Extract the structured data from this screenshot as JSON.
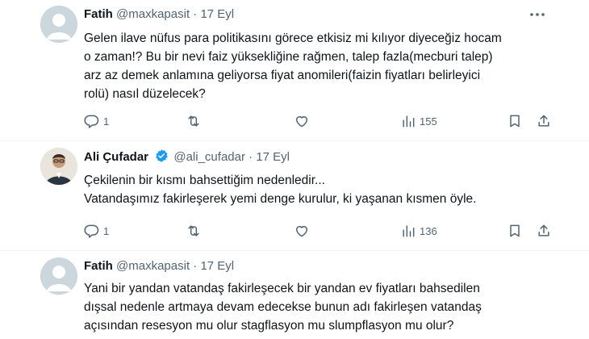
{
  "tweets": [
    {
      "name": "Fatih",
      "handle": "@maxkapasit",
      "dot": "·",
      "date": "17 Eyl",
      "text_lines": [
        "Gelen ilave nüfus para politikasını görece etkisiz mi kılıyor diyeceğiz hocam",
        "o zaman!? Bu bir nevi faiz yüksekliğine rağmen, talep fazla(mecburi talep)",
        "arz az demek anlamına geliyorsa fiyat anomileri(faizin fiyatları belirleyici",
        "rolü) nasıl düzelecek?"
      ],
      "replies": "1",
      "retweets": "",
      "likes": "",
      "views": "155"
    },
    {
      "name": "Ali Çufadar",
      "handle": "@ali_cufadar",
      "dot": "·",
      "date": "17 Eyl",
      "text_lines": [
        "Çekilenin bir kısmı bahsettiğim nedenledir...",
        "Vatandaşımız fakirleşerek yemi denge kurulur, ki yaşanan kısmen öyle."
      ],
      "replies": "1",
      "retweets": "",
      "likes": "",
      "views": "136"
    },
    {
      "name": "Fatih",
      "handle": "@maxkapasit",
      "dot": "·",
      "date": "17 Eyl",
      "text_lines": [
        "Yani bir yandan vatandaş fakirleşecek bir yandan ev fiyatları bahsedilen",
        "dışsal nedenle artmaya devam edecekse bunun adı fakirleşen vatandaş",
        "açısından resesyon mu olur stagflasyon mu slumpflasyon mu olur?"
      ]
    }
  ],
  "icons": {
    "reply": "reply-icon",
    "retweet": "retweet-icon",
    "like": "heart-icon",
    "views": "views-icon",
    "bookmark": "bookmark-icon",
    "share": "share-icon",
    "more": "more-icon",
    "verified": "verified-badge-icon"
  },
  "colors": {
    "verified": "#1d9bf0",
    "muted": "#536471",
    "separator": "#eff3f4"
  }
}
